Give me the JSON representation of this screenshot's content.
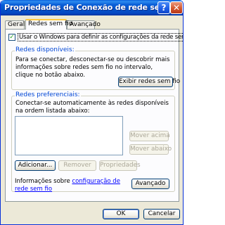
{
  "window": {
    "title": "Propriedades de Conexão de rede sem fio",
    "help_glyph": "?",
    "close_glyph": "✕"
  },
  "tabs": [
    {
      "label": "Geral"
    },
    {
      "label": "Redes sem fio"
    },
    {
      "label": "Avançado"
    }
  ],
  "use_windows": {
    "checked": true,
    "check_glyph": "✓",
    "label": "Usar o Windows para definir as configurações da rede sem fio"
  },
  "available": {
    "title": "Redes disponíveis:",
    "text": "Para se conectar, desconectar-se ou descobrir mais informações sobre redes sem fio no intervalo, clique no botão abaixo.",
    "button": "Exibir redes sem fio"
  },
  "preferred": {
    "title": "Redes preferenciais:",
    "text": "Conectar-se automaticamente às redes disponíveis na ordem listada abaixo:",
    "items": [],
    "move_up": "Mover acima",
    "move_down": "Mover abaixo",
    "add": "Adicionar...",
    "remove": "Remover",
    "properties": "Propriedades"
  },
  "info": {
    "prefix": "Informações sobre ",
    "link": "configuração de rede sem fio",
    "advanced": "Avançado"
  },
  "footer": {
    "ok": "OK",
    "cancel": "Cancelar"
  }
}
